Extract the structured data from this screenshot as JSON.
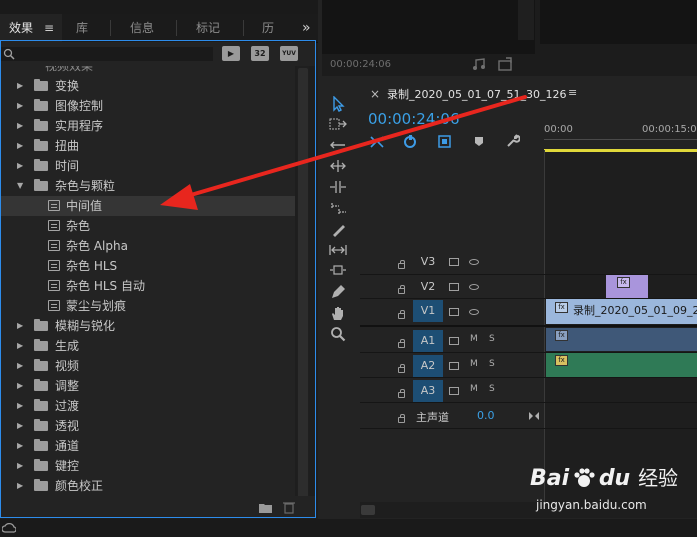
{
  "tabs": [
    {
      "label": "效果",
      "active": true
    },
    {
      "label": "库"
    },
    {
      "label": "信息"
    },
    {
      "label": "标记"
    },
    {
      "label": "历史"
    }
  ],
  "tab_menu_icon": "≡",
  "tab_overflow": "»",
  "accel_buttons": [
    "32",
    "YUV"
  ],
  "tree_top_partial": "视频效果",
  "tree": [
    {
      "label": "变换",
      "type": "folder",
      "expanded": false
    },
    {
      "label": "图像控制",
      "type": "folder",
      "expanded": false
    },
    {
      "label": "实用程序",
      "type": "folder",
      "expanded": false
    },
    {
      "label": "扭曲",
      "type": "folder",
      "expanded": false
    },
    {
      "label": "时间",
      "type": "folder",
      "expanded": false
    },
    {
      "label": "杂色与颗粒",
      "type": "folder",
      "expanded": true
    },
    {
      "label": "中间值",
      "type": "effect",
      "selected": true
    },
    {
      "label": "杂色",
      "type": "effect"
    },
    {
      "label": "杂色 Alpha",
      "type": "effect"
    },
    {
      "label": "杂色 HLS",
      "type": "effect"
    },
    {
      "label": "杂色 HLS 自动",
      "type": "effect"
    },
    {
      "label": "蒙尘与划痕",
      "type": "effect"
    },
    {
      "label": "模糊与锐化",
      "type": "folder",
      "expanded": false
    },
    {
      "label": "生成",
      "type": "folder",
      "expanded": false
    },
    {
      "label": "视频",
      "type": "folder",
      "expanded": false
    },
    {
      "label": "调整",
      "type": "folder",
      "expanded": false
    },
    {
      "label": "过渡",
      "type": "folder",
      "expanded": false
    },
    {
      "label": "透视",
      "type": "folder",
      "expanded": false
    },
    {
      "label": "通道",
      "type": "folder",
      "expanded": false
    },
    {
      "label": "键控",
      "type": "folder",
      "expanded": false
    },
    {
      "label": "颜色校正",
      "type": "folder",
      "expanded": false
    }
  ],
  "monitor": {
    "timecode": "00:00:24:06"
  },
  "timeline": {
    "close": "×",
    "sequence_name": "录制_2020_05_01_07_51_30_126",
    "menu": "≡",
    "timecode": "00:00:24:06",
    "ruler": [
      "00:00",
      "00:00:15:00"
    ],
    "tracks": [
      {
        "name": "V3"
      },
      {
        "name": "V2"
      },
      {
        "name": "V1",
        "clip": "录制_2020_05_01_09_2"
      },
      {
        "name": "A1",
        "m": "M",
        "s": "S"
      },
      {
        "name": "A2",
        "m": "M",
        "s": "S"
      },
      {
        "name": "A3",
        "m": "M",
        "s": "S"
      }
    ],
    "master_label": "主声道",
    "master_value": "0.0"
  },
  "colors": {
    "accent": "#2d8ceb",
    "timecode": "#3aa0e6",
    "arrow": "#e8261e",
    "v1_clip": "#9bb7dc",
    "v2_clip": "#a995dc",
    "a1_clip": "#3f5878",
    "a2_clip": "#2f7a56"
  },
  "watermark": {
    "brand": "Bai",
    "brand2": "du",
    "cn": "经验",
    "url": "jingyan.baidu.com"
  }
}
